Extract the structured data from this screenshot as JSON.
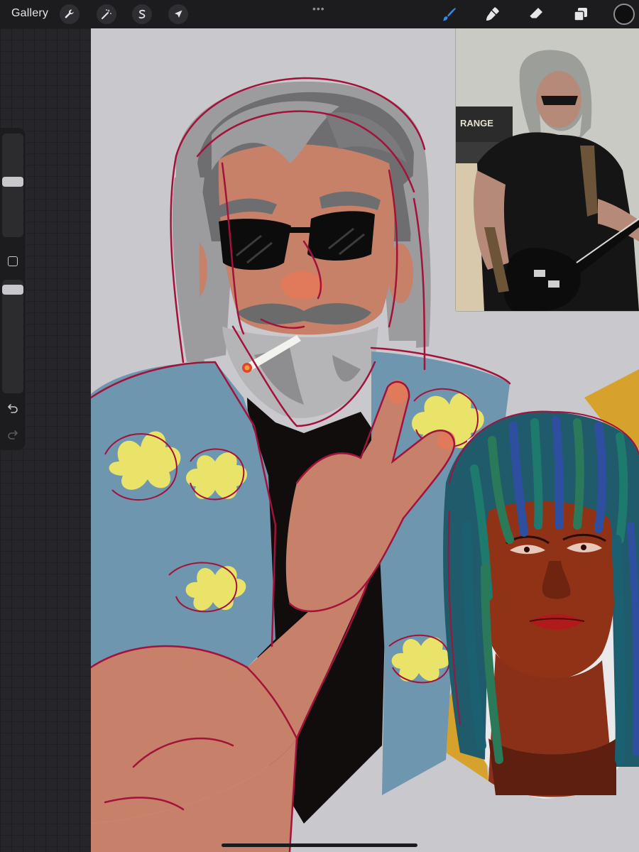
{
  "toolbar": {
    "gallery_label": "Gallery",
    "left_tools": [
      {
        "name": "actions",
        "icon": "wrench-icon"
      },
      {
        "name": "adjustments",
        "icon": "magic-wand-icon"
      },
      {
        "name": "selection",
        "icon": "selection-s-icon"
      },
      {
        "name": "transform",
        "icon": "arrow-cursor-icon"
      }
    ],
    "more_label": "•••",
    "right_tools": [
      {
        "name": "brush",
        "icon": "brush-icon",
        "active": true
      },
      {
        "name": "smudge",
        "icon": "smudge-icon",
        "active": false
      },
      {
        "name": "eraser",
        "icon": "eraser-icon",
        "active": false
      },
      {
        "name": "layers",
        "icon": "layers-icon",
        "active": false
      }
    ],
    "current_color": "#0f0f0f",
    "active_color": "#2f8cf2"
  },
  "sidebar": {
    "brush_size_level": 0.54,
    "opacity_level": 0.95,
    "modify_icon": "square-icon",
    "undo_icon": "undo-icon",
    "redo_icon": "redo-icon"
  },
  "canvas": {
    "background": "#c9c9cd",
    "reference_photo_text": "RANGE"
  }
}
